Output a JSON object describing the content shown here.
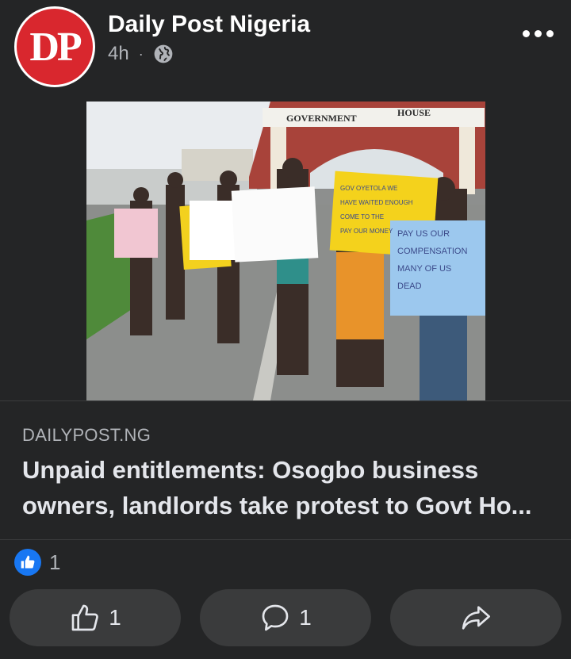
{
  "post": {
    "page_name": "Daily Post Nigeria",
    "avatar_text": "DP",
    "time": "4h",
    "separator": "·",
    "privacy_icon": "globe-icon",
    "more_icon": "more-horizontal-icon"
  },
  "photo": {
    "sign_gate_left": "GOVERNMENT",
    "sign_gate_right": "HOUSE",
    "placard_1": "PAY US OUR COMPENSATION MANY OF US DEAD",
    "placard_2": "GOV OYETOLA WE HAVE WAITED ENOUGH COME TO THE PAY OUR MONEY"
  },
  "link": {
    "domain": "DAILYPOST.NG",
    "headline": "Unpaid entitlements: Osogbo business owners, landlords take protest to Govt Ho..."
  },
  "reactions": {
    "icon": "like-badge-icon",
    "count": "1"
  },
  "actions": {
    "like_count": "1",
    "comment_count": "1",
    "like_icon": "thumbs-up-icon",
    "comment_icon": "comment-icon",
    "share_icon": "share-icon"
  },
  "colors": {
    "background": "#242526",
    "button": "#3a3b3c",
    "brand_red": "#d9272e",
    "like_blue": "#1877f2"
  }
}
